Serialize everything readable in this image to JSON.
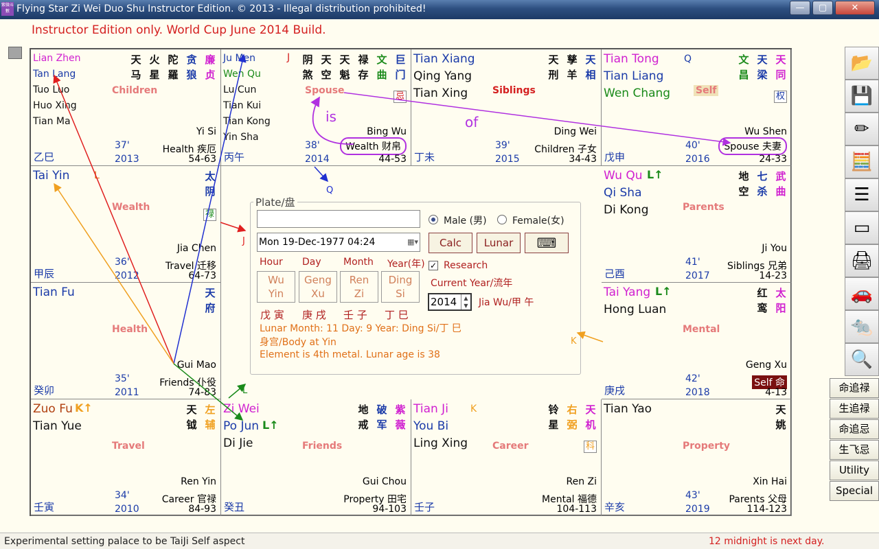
{
  "window": {
    "icon_text": "紫微斗數",
    "title": "Flying Star Zi Wei Duo Shu Instructor Edition. © 2013 - Illegal distribution prohibited!",
    "min_label": "—",
    "max_label": "▢",
    "close_label": "✕"
  },
  "subtitle": "Instructor Edition only. World Cup June 2014 Build.",
  "palaces": [
    {
      "id": "yi-si",
      "stars": [
        "Lian Zhen",
        "Tan Lang",
        "Tuo Luo",
        "Huo Xing",
        "Tian Ma"
      ],
      "cn_columns": [
        "天马",
        "火星",
        "陀羅",
        "贪狼",
        "廉贞"
      ],
      "name": "Children",
      "branch": "Yi Si",
      "role": "Health 疾厄",
      "age": "37'",
      "year": "2013",
      "range": "54-63",
      "stem": "乙巳"
    },
    {
      "id": "bing-wu",
      "stars": [
        "Ju Men",
        "Wen Qu",
        "Lu Cun",
        "Tian Kui",
        "Tian Kong",
        "Yin Sha"
      ],
      "cn_columns": [
        "阴煞",
        "天空",
        "天魁",
        "禄存",
        "文曲",
        "巨门"
      ],
      "name": "Spouse",
      "branch": "Bing Wu",
      "role": "Wealth 财帛",
      "age": "38'",
      "year": "2014",
      "range": "44-53",
      "stem": "丙午",
      "mut_j": "J",
      "boxed": "忌",
      "is_label": "is"
    },
    {
      "id": "ding-wei",
      "stars": [
        "Tian Xiang",
        "Qing Yang",
        "Tian Xing"
      ],
      "cn_columns": [
        "天刑",
        "孳羊",
        "天相"
      ],
      "name": "Siblings",
      "branch": "Ding Wei",
      "role": "Children 子女",
      "age": "39'",
      "year": "2015",
      "range": "34-43",
      "stem": "丁未",
      "of_label": "of"
    },
    {
      "id": "wu-shen",
      "stars": [
        "Tian Tong",
        "Tian Liang",
        "Wen Chang"
      ],
      "cn_columns": [
        "文昌",
        "天梁",
        "天同"
      ],
      "name": "Self",
      "branch": "Wu Shen",
      "role": "Spouse 夫妻",
      "age": "40'",
      "year": "2016",
      "range": "24-33",
      "stem": "戊申",
      "mut_q": "Q",
      "boxed": "权"
    },
    {
      "id": "jia-chen",
      "stars": [
        "Tai Yin"
      ],
      "cn_columns": [
        "太阴"
      ],
      "name": "Wealth",
      "branch": "Jia Chen",
      "role": "Travel 迁移",
      "age": "36'",
      "year": "2012",
      "range": "64-73",
      "stem": "甲辰",
      "mut_l": "L",
      "boxed": "禄"
    },
    {
      "id": "ji-you",
      "stars": [
        "Wu Qu",
        "Qi Sha",
        "Di Kong"
      ],
      "cn_columns": [
        "地空",
        "七杀",
        "武曲"
      ],
      "name": "Parents",
      "branch": "Ji You",
      "role": "Siblings 兄弟",
      "age": "41'",
      "year": "2017",
      "range": "14-23",
      "stem": "己酉",
      "lu": "L↑"
    },
    {
      "id": "gui-mao",
      "stars": [
        "Tian Fu"
      ],
      "cn_columns": [
        "天府"
      ],
      "name": "Health",
      "branch": "Gui Mao",
      "role": "Friends 仆役",
      "age": "35'",
      "year": "2011",
      "range": "74-83",
      "stem": "癸卯"
    },
    {
      "id": "geng-xu",
      "stars": [
        "Tai Yang",
        "Hong Luan"
      ],
      "cn_columns": [
        "红鸾",
        "太阳"
      ],
      "name": "Mental",
      "branch": "Geng Xu",
      "role": "Self 命",
      "age": "42'",
      "year": "2018",
      "range": "4-13",
      "stem": "庚戌",
      "lu": "L↑",
      "mut_k": "K"
    },
    {
      "id": "ren-yin",
      "stars": [
        "Zuo Fu",
        "Tian Yue"
      ],
      "cn_columns": [
        "天钺",
        "左辅"
      ],
      "name": "Travel",
      "branch": "Ren Yin",
      "role": "Career 官禄",
      "age": "34'",
      "year": "2010",
      "range": "84-93",
      "stem": "壬寅",
      "ku": "K↑"
    },
    {
      "id": "gui-chou",
      "stars": [
        "Zi Wei",
        "Po Jun",
        "Di Jie"
      ],
      "cn_columns": [
        "地戒",
        "破军",
        "紫薇"
      ],
      "name": "Friends",
      "branch": "Gui Chou",
      "role": "Property 田宅",
      "age": "",
      "year": "",
      "range": "94-103",
      "stem": "癸丑",
      "lu": "L↑"
    },
    {
      "id": "ren-zi",
      "stars": [
        "Tian Ji",
        "You Bi",
        "Ling Xing"
      ],
      "cn_columns": [
        "铃星",
        "右弼",
        "天机"
      ],
      "name": "Career",
      "branch": "Ren Zi",
      "role": "Mental 福德",
      "age": "",
      "year": "",
      "range": "104-113",
      "stem": "壬子",
      "mut_k": "K",
      "boxed": "科"
    },
    {
      "id": "xin-hai",
      "stars": [
        "Tian Yao"
      ],
      "cn_columns": [
        "天姚"
      ],
      "name": "Property",
      "branch": "Xin Hai",
      "role": "Parents 父母",
      "age": "43'",
      "year": "2019",
      "range": "114-123",
      "stem": "辛亥"
    }
  ],
  "plate": {
    "legend": "Plate/盘",
    "name_value": "",
    "date_value": "Mon 19-Dec-1977 04:24",
    "male_label": "Male (男)",
    "female_label": "Female(女)",
    "calc_label": "Calc",
    "lunar_label": "Lunar",
    "keyboard_label": "⌨",
    "pillar_heads": [
      "Hour",
      "Day",
      "Month",
      "Year(年)"
    ],
    "pillars": [
      [
        "Wu",
        "Yin"
      ],
      [
        "Geng",
        "Xu"
      ],
      [
        "Ren",
        "Zi"
      ],
      [
        "Ding",
        "Si"
      ]
    ],
    "pillar_cn": [
      "戊 寅",
      "庚 戌",
      "壬 子",
      "丁 巳"
    ],
    "research_label": "Research",
    "current_year_label": "Current Year/流年",
    "year_value": "2014",
    "year_ganzhi": "Jia Wu/甲 午",
    "lunar_line": "Lunar Month: 11   Day: 9   Year: Ding Si/丁 巳",
    "body_line": "身宫/Body at Yin",
    "element_line": "Element is 4th metal.   Lunar age is 38"
  },
  "arrow_labels": {
    "j1": "J",
    "q1": "Q",
    "l1": "L",
    "k1": "K"
  },
  "menu": [
    "命追禄",
    "生追禄",
    "命追忌",
    "生飞忌",
    "Utility",
    "Special"
  ],
  "sidebar_icons": [
    "📂",
    "💾",
    "✏",
    "🧮",
    "☰",
    "▭",
    "🖨",
    "🚗",
    "🐀",
    "🔍"
  ],
  "status": {
    "left": "Experimental setting palace to be TaiJi Self aspect",
    "right": "12 midnight is next day."
  },
  "colors": {
    "red": "#d42020",
    "blue": "#1a3aa8",
    "magenta": "#d020d0",
    "green": "#1a8a1a",
    "orange": "#f0a020",
    "purple": "#b030e0"
  }
}
